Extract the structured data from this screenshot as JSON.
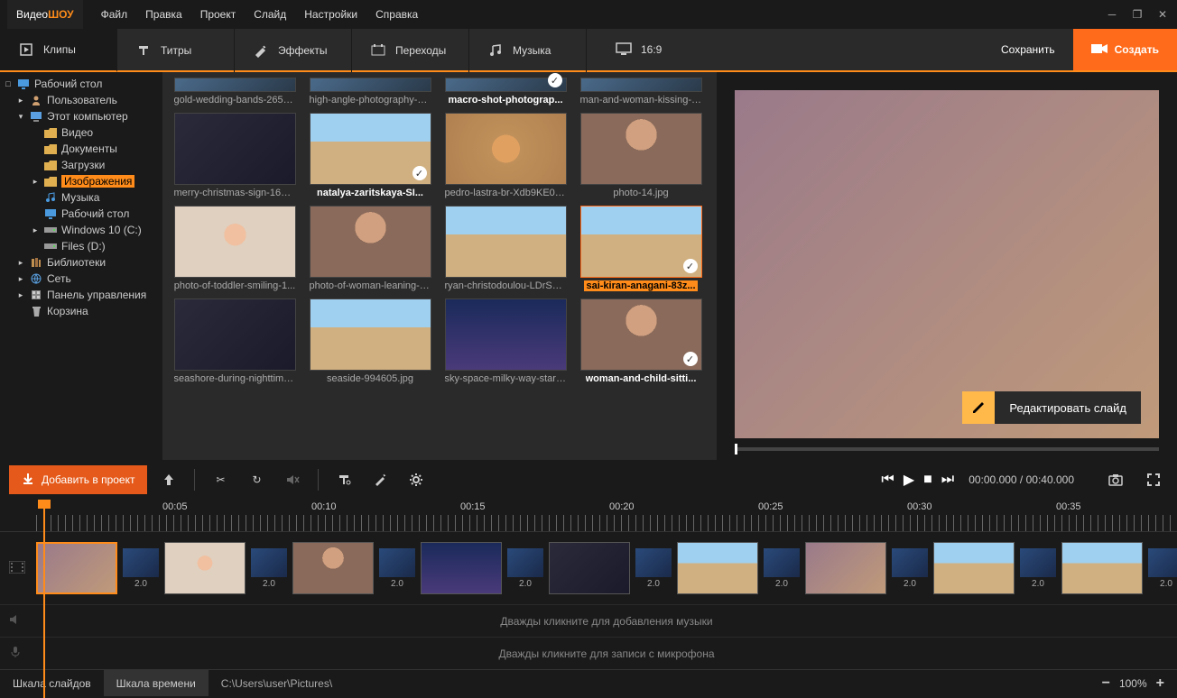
{
  "app": {
    "name1": "Видео",
    "name2": "ШОУ"
  },
  "menu": [
    "Файл",
    "Правка",
    "Проект",
    "Слайд",
    "Настройки",
    "Справка"
  ],
  "tabs": [
    {
      "id": "clips",
      "label": "Клипы"
    },
    {
      "id": "titles",
      "label": "Титры"
    },
    {
      "id": "effects",
      "label": "Эффекты"
    },
    {
      "id": "transitions",
      "label": "Переходы"
    },
    {
      "id": "music",
      "label": "Музыка"
    }
  ],
  "aspect": "16:9",
  "save_label": "Сохранить",
  "create_label": "Создать",
  "tree": [
    {
      "l": "Рабочий стол",
      "i": 0,
      "t": "□",
      "ic": "desktop"
    },
    {
      "l": "Пользователь",
      "i": 1,
      "t": "▸",
      "ic": "user"
    },
    {
      "l": "Этот компьютер",
      "i": 1,
      "t": "▾",
      "ic": "pc"
    },
    {
      "l": "Видео",
      "i": 2,
      "t": "",
      "ic": "folder"
    },
    {
      "l": "Документы",
      "i": 2,
      "t": "",
      "ic": "folder"
    },
    {
      "l": "Загрузки",
      "i": 2,
      "t": "",
      "ic": "folder"
    },
    {
      "l": "Изображения",
      "i": 2,
      "t": "▸",
      "ic": "folder",
      "sel": true
    },
    {
      "l": "Музыка",
      "i": 2,
      "t": "",
      "ic": "music"
    },
    {
      "l": "Рабочий стол",
      "i": 2,
      "t": "",
      "ic": "desktop"
    },
    {
      "l": "Windows 10 (C:)",
      "i": 2,
      "t": "▸",
      "ic": "drive"
    },
    {
      "l": "Files (D:)",
      "i": 2,
      "t": "",
      "ic": "drive"
    },
    {
      "l": "Библиотеки",
      "i": 1,
      "t": "▸",
      "ic": "lib"
    },
    {
      "l": "Сеть",
      "i": 1,
      "t": "▸",
      "ic": "net"
    },
    {
      "l": "Панель управления",
      "i": 1,
      "t": "▸",
      "ic": "panel"
    },
    {
      "l": "Корзина",
      "i": 1,
      "t": "",
      "ic": "trash"
    }
  ],
  "thumbs": [
    {
      "l": "gold-wedding-bands-2657...",
      "row0": true
    },
    {
      "l": "high-angle-photography-o...",
      "row0": true
    },
    {
      "l": "macro-shot-photograp...",
      "b": true,
      "chk": true,
      "row0": true
    },
    {
      "l": "man-and-woman-kissing-2...",
      "row0": true
    },
    {
      "l": "merry-christmas-sign-1656...",
      "c": "t-dark"
    },
    {
      "l": "natalya-zaritskaya-SI...",
      "b": true,
      "chk": true,
      "c": "t-beach"
    },
    {
      "l": "pedro-lastra-br-Xdb9KE0Q...",
      "c": "t-star"
    },
    {
      "l": "photo-14.jpg",
      "c": "t-portrait"
    },
    {
      "l": "photo-of-toddler-smiling-1...",
      "c": "t-kid"
    },
    {
      "l": "photo-of-woman-leaning-o...",
      "c": "t-portrait"
    },
    {
      "l": "ryan-christodoulou-LDrSJ3...",
      "c": "t-beach"
    },
    {
      "l": "sai-kiran-anagani-83z...",
      "b": true,
      "chk": true,
      "sel": true,
      "c": "t-beach"
    },
    {
      "l": "seashore-during-nighttime...",
      "c": "t-dark"
    },
    {
      "l": "seaside-994605.jpg",
      "c": "t-beach"
    },
    {
      "l": "sky-space-milky-way-stars-...",
      "c": "t-night"
    },
    {
      "l": "woman-and-child-sitti...",
      "b": true,
      "chk": true,
      "c": "t-portrait"
    }
  ],
  "edit_slide": "Редактировать слайд",
  "add_project": "Добавить в проект",
  "time_current": "00:00.000",
  "time_total": "00:40.000",
  "ruler": [
    "00:05",
    "00:10",
    "00:15",
    "00:20",
    "00:25",
    "00:30",
    "00:35"
  ],
  "clips": [
    {
      "sel": true,
      "c": "t-family"
    },
    {
      "dur": "2.0"
    },
    {
      "c": "t-kid"
    },
    {
      "dur": "2.0"
    },
    {
      "c": "t-portrait"
    },
    {
      "dur": "2.0"
    },
    {
      "c": "t-night"
    },
    {
      "dur": "2.0"
    },
    {
      "c": "t-dark"
    },
    {
      "dur": "2.0"
    },
    {
      "c": "t-beach"
    },
    {
      "dur": "2.0"
    },
    {
      "c": "t-family"
    },
    {
      "dur": "2.0"
    },
    {
      "c": "t-beach"
    },
    {
      "dur": "2.0"
    },
    {
      "c": "t-beach"
    },
    {
      "dur": "2.0"
    }
  ],
  "hint_music": "Дважды кликните для добавления музыки",
  "hint_mic": "Дважды кликните для записи с микрофона",
  "status": {
    "slides": "Шкала слайдов",
    "timeline": "Шкала времени",
    "path": "C:\\Users\\user\\Pictures\\",
    "zoom": "100%"
  }
}
